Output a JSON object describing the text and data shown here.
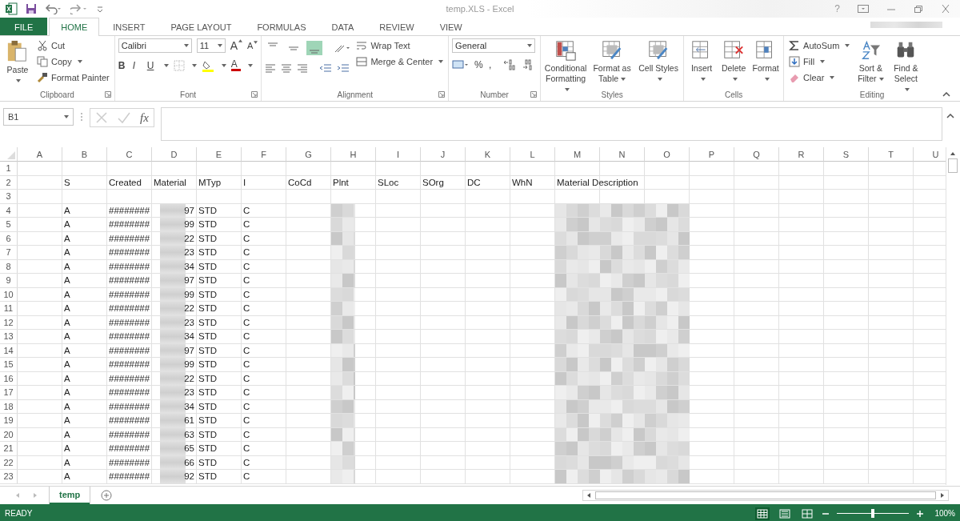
{
  "title_bar": {
    "title": "temp.XLS - Excel",
    "help": "?"
  },
  "tabs": [
    {
      "label": "FILE",
      "kind": "file",
      "selected": false
    },
    {
      "label": "HOME",
      "kind": "tab",
      "selected": true
    },
    {
      "label": "INSERT",
      "kind": "tab",
      "selected": false
    },
    {
      "label": "PAGE LAYOUT",
      "kind": "tab",
      "selected": false
    },
    {
      "label": "FORMULAS",
      "kind": "tab",
      "selected": false
    },
    {
      "label": "DATA",
      "kind": "tab",
      "selected": false
    },
    {
      "label": "REVIEW",
      "kind": "tab",
      "selected": false
    },
    {
      "label": "VIEW",
      "kind": "tab",
      "selected": false
    }
  ],
  "ribbon": {
    "clipboard": {
      "label": "Clipboard",
      "paste": "Paste",
      "cut": "Cut",
      "copy": "Copy",
      "format_painter": "Format Painter"
    },
    "font": {
      "label": "Font",
      "family": "Calibri",
      "size": "11",
      "grow": "A",
      "shrink": "A",
      "bold": "B",
      "italic": "I",
      "underline": "U",
      "font_color": "A"
    },
    "alignment": {
      "label": "Alignment",
      "vertical": [
        {
          "selected": false
        },
        {
          "selected": false
        },
        {
          "selected": true
        }
      ],
      "wrap_text": "Wrap Text",
      "merge_center": "Merge & Center"
    },
    "number": {
      "label": "Number",
      "format": "General",
      "percent": "%",
      "comma": ","
    },
    "styles": {
      "label": "Styles",
      "items": [
        "Conditional Formatting",
        "Format as Table",
        "Cell Styles"
      ]
    },
    "cells": {
      "label": "Cells",
      "items": [
        "Insert",
        "Delete",
        "Format"
      ]
    },
    "editing": {
      "label": "Editing",
      "autosum": "AutoSum",
      "fill": "Fill",
      "clear": "Clear",
      "sort": "Sort & Filter",
      "find": "Find & Select"
    }
  },
  "formula_bar": {
    "name_box": "B1",
    "fx": "fx"
  },
  "columns": [
    "A",
    "B",
    "C",
    "D",
    "E",
    "F",
    "G",
    "H",
    "I",
    "J",
    "K",
    "L",
    "M",
    "N",
    "O",
    "P",
    "Q",
    "R",
    "S",
    "T",
    "U"
  ],
  "rows": [
    {
      "number": "1",
      "blurred": false,
      "cells": {}
    },
    {
      "number": "2",
      "blurred": false,
      "cells": {
        "B": "S",
        "C": "Created",
        "D": "Material",
        "E": "MTyp",
        "F": "I",
        "G": "CoCd",
        "H": "Plnt",
        "I": "SLoc",
        "J": "SOrg",
        "K": "DC",
        "L": "WhN",
        "M": "Material Description"
      }
    },
    {
      "number": "3",
      "blurred": false,
      "cells": {}
    },
    {
      "number": "4",
      "blurred": true,
      "cells": {
        "B": "A",
        "C": "########",
        "D": "97",
        "E": "STD",
        "F": "C"
      }
    },
    {
      "number": "5",
      "blurred": true,
      "cells": {
        "B": "A",
        "C": "########",
        "D": "99",
        "E": "STD",
        "F": "C"
      }
    },
    {
      "number": "6",
      "blurred": true,
      "cells": {
        "B": "A",
        "C": "########",
        "D": "22",
        "E": "STD",
        "F": "C"
      }
    },
    {
      "number": "7",
      "blurred": true,
      "cells": {
        "B": "A",
        "C": "########",
        "D": "23",
        "E": "STD",
        "F": "C"
      }
    },
    {
      "number": "8",
      "blurred": true,
      "cells": {
        "B": "A",
        "C": "########",
        "D": "34",
        "E": "STD",
        "F": "C"
      }
    },
    {
      "number": "9",
      "blurred": true,
      "cells": {
        "B": "A",
        "C": "########",
        "D": "97",
        "E": "STD",
        "F": "C"
      }
    },
    {
      "number": "10",
      "blurred": true,
      "cells": {
        "B": "A",
        "C": "########",
        "D": "99",
        "E": "STD",
        "F": "C"
      }
    },
    {
      "number": "11",
      "blurred": true,
      "cells": {
        "B": "A",
        "C": "########",
        "D": "22",
        "E": "STD",
        "F": "C"
      }
    },
    {
      "number": "12",
      "blurred": true,
      "cells": {
        "B": "A",
        "C": "########",
        "D": "23",
        "E": "STD",
        "F": "C"
      }
    },
    {
      "number": "13",
      "blurred": true,
      "cells": {
        "B": "A",
        "C": "########",
        "D": "34",
        "E": "STD",
        "F": "C"
      }
    },
    {
      "number": "14",
      "blurred": true,
      "cells": {
        "B": "A",
        "C": "########",
        "D": "97",
        "E": "STD",
        "F": "C"
      }
    },
    {
      "number": "15",
      "blurred": true,
      "cells": {
        "B": "A",
        "C": "########",
        "D": "99",
        "E": "STD",
        "F": "C"
      }
    },
    {
      "number": "16",
      "blurred": true,
      "cells": {
        "B": "A",
        "C": "########",
        "D": "22",
        "E": "STD",
        "F": "C"
      }
    },
    {
      "number": "17",
      "blurred": true,
      "cells": {
        "B": "A",
        "C": "########",
        "D": "23",
        "E": "STD",
        "F": "C"
      }
    },
    {
      "number": "18",
      "blurred": true,
      "cells": {
        "B": "A",
        "C": "########",
        "D": "34",
        "E": "STD",
        "F": "C"
      }
    },
    {
      "number": "19",
      "blurred": true,
      "cells": {
        "B": "A",
        "C": "########",
        "D": "61",
        "E": "STD",
        "F": "C"
      }
    },
    {
      "number": "20",
      "blurred": true,
      "cells": {
        "B": "A",
        "C": "########",
        "D": "63",
        "E": "STD",
        "F": "C"
      }
    },
    {
      "number": "21",
      "blurred": true,
      "cells": {
        "B": "A",
        "C": "########",
        "D": "65",
        "E": "STD",
        "F": "C"
      }
    },
    {
      "number": "22",
      "blurred": true,
      "cells": {
        "B": "A",
        "C": "########",
        "D": "66",
        "E": "STD",
        "F": "C"
      }
    },
    {
      "number": "23",
      "blurred": true,
      "cells": {
        "B": "A",
        "C": "########",
        "D": "92",
        "E": "STD",
        "F": "C"
      }
    }
  ],
  "sheet_tabs": [
    {
      "label": "temp",
      "selected": true
    }
  ],
  "status_bar": {
    "status": "READY",
    "views": [
      {
        "selected": true
      },
      {
        "selected": false
      },
      {
        "selected": false
      }
    ],
    "zoom": {
      "level": 0.5
    },
    "zoom_label": "100%"
  }
}
